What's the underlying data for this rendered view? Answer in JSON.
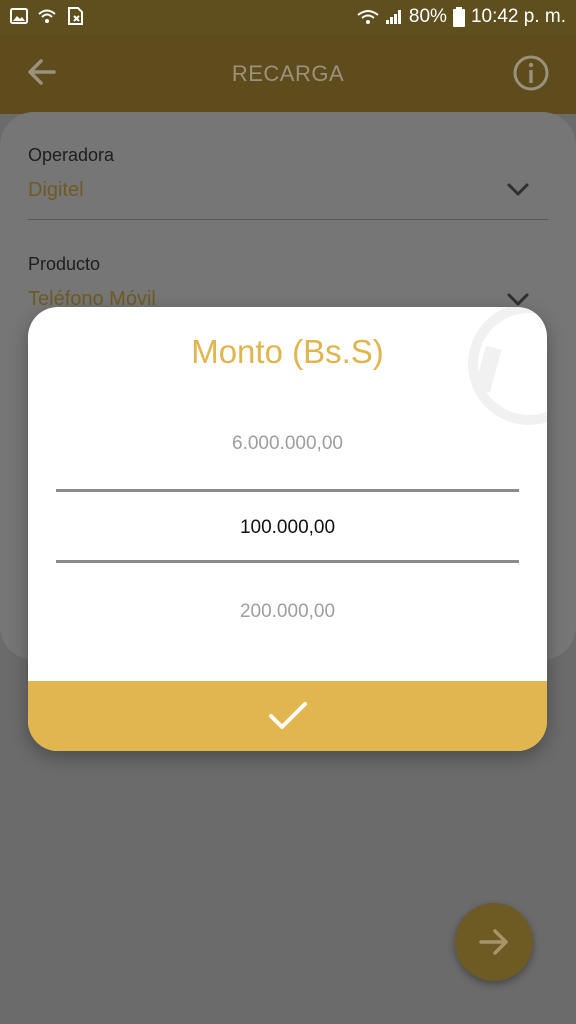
{
  "status_bar": {
    "battery": "80%",
    "time": "10:42 p. m."
  },
  "toolbar": {
    "title": "RECARGA",
    "back_icon": "arrow-left-icon",
    "info_icon": "info-icon"
  },
  "form": {
    "operadora": {
      "label": "Operadora",
      "value": "Digitel"
    },
    "producto": {
      "label": "Producto",
      "value": "Teléfono Móvil"
    }
  },
  "dialog": {
    "title": "Monto (Bs.S)",
    "options": [
      "6.000.000,00",
      "100.000,00",
      "200.000,00"
    ],
    "selected": "100.000,00",
    "confirm_icon": "checkmark-icon"
  },
  "fab": {
    "icon": "arrow-right-icon"
  },
  "colors": {
    "accent": "#e1b64f",
    "toolbar_dimmed": "#5e4c1d",
    "scrim": "#6b6b6b"
  }
}
